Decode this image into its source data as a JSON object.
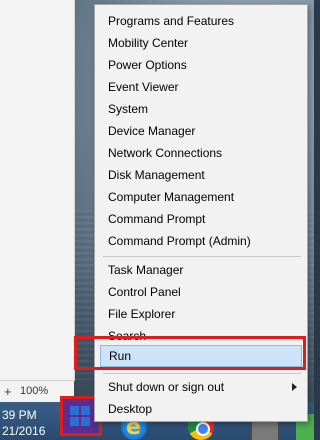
{
  "menu": {
    "items": [
      {
        "label": "Programs and Features"
      },
      {
        "label": "Mobility Center"
      },
      {
        "label": "Power Options"
      },
      {
        "label": "Event Viewer"
      },
      {
        "label": "System"
      },
      {
        "label": "Device Manager"
      },
      {
        "label": "Network Connections"
      },
      {
        "label": "Disk Management"
      },
      {
        "label": "Computer Management"
      },
      {
        "label": "Command Prompt"
      },
      {
        "label": "Command Prompt (Admin)"
      },
      {
        "label": "Task Manager"
      },
      {
        "label": "Control Panel"
      },
      {
        "label": "File Explorer"
      },
      {
        "label": "Search"
      },
      {
        "label": "Run",
        "selected": true
      },
      {
        "label": "Shut down or sign out",
        "has_submenu": true
      },
      {
        "label": "Desktop"
      }
    ]
  },
  "app_panel": {
    "zoom_plus": "+",
    "zoom_level": "100%"
  },
  "taskbar": {
    "time": "39 PM",
    "date": "21/2016"
  },
  "colors": {
    "menu_bg": "#f2f2f2",
    "selected_bg": "#cde3f7",
    "highlight_border": "#e31b1b",
    "start_button_bg": "#5a2d91"
  },
  "icons": {
    "start": "windows-logo-icon",
    "browser1": "internet-explorer-icon",
    "browser2": "chrome-icon",
    "files": "file-explorer-icon",
    "submenu": "chevron-right-icon"
  }
}
